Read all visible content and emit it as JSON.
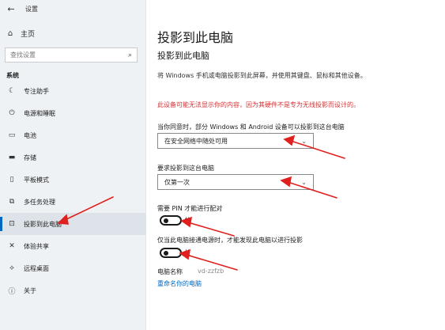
{
  "window": {
    "back_symbol": "←",
    "title": "设置"
  },
  "sidebar": {
    "home_label": "主页",
    "search_placeholder": "查找设置",
    "section_label": "系统",
    "items": [
      {
        "label": "专注助手",
        "icon": "moon-icon"
      },
      {
        "label": "电源和睡眠",
        "icon": "power-icon"
      },
      {
        "label": "电池",
        "icon": "battery-icon"
      },
      {
        "label": "存储",
        "icon": "storage-icon"
      },
      {
        "label": "平板模式",
        "icon": "tablet-icon"
      },
      {
        "label": "多任务处理",
        "icon": "multitask-icon"
      },
      {
        "label": "投影到此电脑",
        "icon": "project-icon",
        "active": true
      },
      {
        "label": "体验共享",
        "icon": "share-icon"
      },
      {
        "label": "远程桌面",
        "icon": "remote-icon"
      },
      {
        "label": "关于",
        "icon": "info-icon"
      }
    ]
  },
  "main": {
    "page_title": "投影到此电脑",
    "section_title": "投影到此电脑",
    "description": "将 Windows 手机或电脑投影到此屏幕，并使用其键盘、鼠标和其他设备。",
    "warning": "此设备可能无法显示你的内容，因为其硬件不是专为无线投影而设计的。",
    "availability_label": "当你同意时，部分 Windows 和 Android 设备可以投影到这台电脑",
    "availability_value": "在安全网络中随处可用",
    "ask_label": "要求投影到这台电脑",
    "ask_value": "仅第一次",
    "pin_label": "需要 PIN 才能进行配对",
    "pin_state": "关",
    "power_label": "仅当此电脑接通电源时，才能发现此电脑以进行投影",
    "power_state": "关",
    "pc_name_label": "电脑名称",
    "pc_name_value": "vd-zzfzb",
    "rename_link": "重命名你的电脑"
  },
  "colors": {
    "accent": "#0067c0",
    "warning": "#d13438",
    "annotation": "#e0201e"
  }
}
